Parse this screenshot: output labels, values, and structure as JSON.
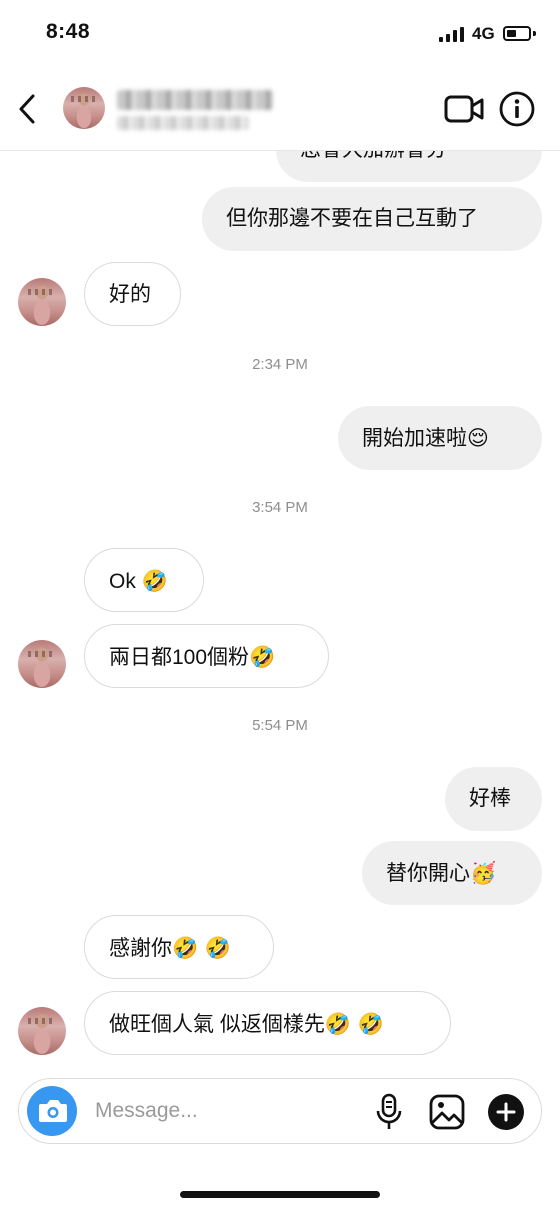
{
  "status_bar": {
    "time": "8:48",
    "network": "4G"
  },
  "header": {
    "contact_name": "███████",
    "contact_subtitle": "██████"
  },
  "messages": {
    "partial_top": "您會大加辦會分",
    "m1": "但你那邊不要在自己互動了",
    "m2": "好的",
    "ts1": "2:34 PM",
    "m3_text": "開始加速啦",
    "m3_emoji": "😌",
    "ts2": "3:54 PM",
    "m4_text": "Ok ",
    "m4_emoji": "🤣",
    "m5_text": "兩日都100個粉",
    "m5_emoji": "🤣",
    "ts3": "5:54 PM",
    "m6": "好棒",
    "m7_text": "替你開心",
    "m7_emoji": "🥳",
    "m8_text": "感謝你",
    "m8_emoji": "🤣 🤣",
    "m9_text": "做旺個人氣 似返個樣先",
    "m9_emoji": "🤣 🤣"
  },
  "composer": {
    "placeholder": "Message..."
  },
  "colors": {
    "accent": "#3897f0",
    "bubble_out": "#efefef",
    "border": "#dbdbdb",
    "timestamp": "#8e8e8e"
  }
}
